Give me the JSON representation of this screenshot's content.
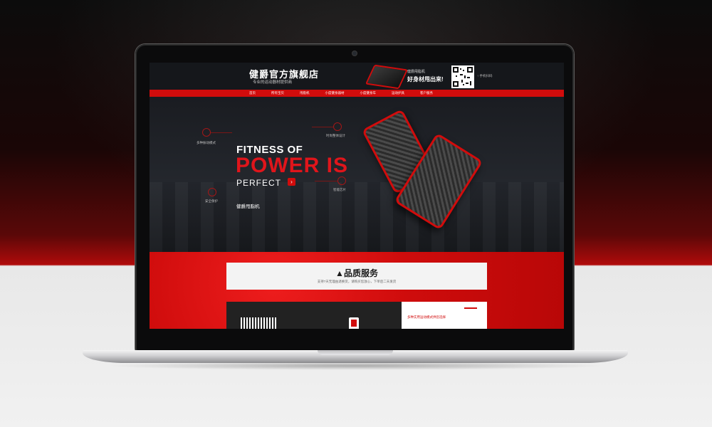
{
  "store": {
    "name": "健爵官方旗舰店",
    "slogan": "专业的运动器材提供商",
    "promo_small": "健爵甩脂机",
    "promo_big": "好身材甩出来!",
    "qr_caption": "↑ 手机扫码"
  },
  "nav": {
    "items": [
      "首页",
      "所有宝贝",
      "甩脂机",
      "小度健身器材",
      "小度健身车",
      "运动护具",
      "客户服务"
    ]
  },
  "hero": {
    "line1": "FITNESS OF",
    "line2": "POWER IS",
    "line3": "PERFECT",
    "subtitle": "健爵甩脂机",
    "arrow": "›",
    "features": [
      "多种振动模式",
      "时尚整体设计",
      "安全保护",
      "智能芯片"
    ]
  },
  "quality": {
    "title": "品质服务",
    "icon": "warning-icon",
    "description": "支持7天无理由退换货，请购买您放心，下单后二天发货",
    "card_text": "多种实用运动模式供您选择"
  },
  "colors": {
    "accent": "#d10c0c",
    "dark": "#1b1d22",
    "headline_red": "#e0151b"
  }
}
